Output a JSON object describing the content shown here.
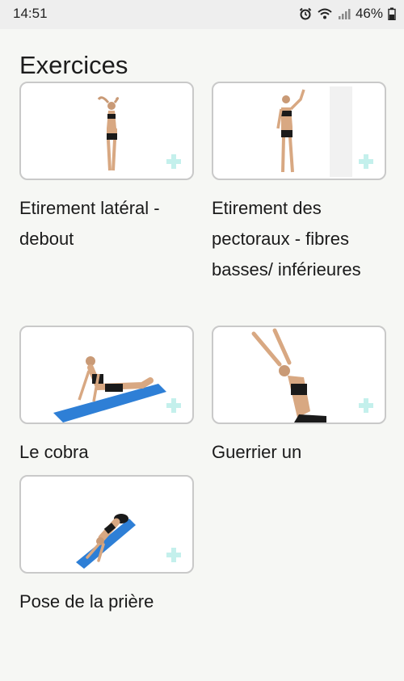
{
  "status_bar": {
    "time": "14:51",
    "battery": "46%",
    "icons": [
      "alarm-icon",
      "wifi-icon",
      "signal-icon",
      "battery-icon"
    ]
  },
  "page": {
    "title": "Exercices"
  },
  "exercises": [
    {
      "label": "Etirement latéral - debout"
    },
    {
      "label": "Etirement des pectoraux - fibres basses/ inférieures"
    },
    {
      "label": "Le cobra"
    },
    {
      "label": "Guerrier un"
    },
    {
      "label": "Pose de la prière"
    }
  ],
  "colors": {
    "background": "#f6f7f4",
    "card_border": "#c9c9c9",
    "add_icon": "#c4f0ec",
    "mat": "#2e7fd6"
  }
}
